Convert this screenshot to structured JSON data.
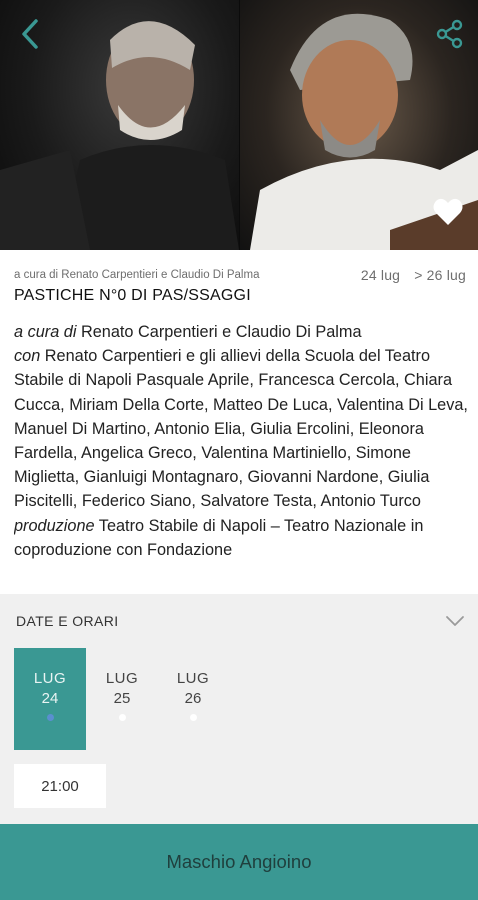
{
  "hero": {
    "back_icon": "chevron-left-icon",
    "share_icon": "share-icon",
    "favorite_icon": "heart-icon",
    "accent_color": "#3a9893"
  },
  "show": {
    "credit": "a cura di Renato Carpentieri e Claudio Di Palma",
    "date_start": "24 lug",
    "date_end": "> 26 lug",
    "title": "PASTICHE N°0 DI PAS/SSAGGI",
    "description": [
      {
        "label": "a cura di",
        "text": " Renato Carpentieri e Claudio Di Palma"
      },
      {
        "label": "con",
        "text": " Renato Carpentieri e gli allievi della Scuola del Teatro Stabile di Napoli Pasquale Aprile, Francesca Cercola, Chiara Cucca, Miriam Della Corte, Matteo De Luca, Valentina Di Leva, Manuel Di Martino, Antonio Elia, Giulia Ercolini, Eleonora Fardella, Angelica Greco, Valentina Martiniello, Simone Miglietta, Gianluigi Montagnaro, Giovanni Nardone, Giulia Piscitelli, Federico Siano, Salvatore Testa, Antonio Turco"
      },
      {
        "label": "produzione",
        "text": " Teatro Stabile di Napoli – Teatro Nazionale in coproduzione con Fondazione"
      }
    ]
  },
  "schedule": {
    "heading": "DATE E ORARI",
    "chevron_icon": "chevron-down-icon",
    "days": [
      {
        "month": "LUG",
        "day": "24",
        "selected": true
      },
      {
        "month": "LUG",
        "day": "25",
        "selected": false
      },
      {
        "month": "LUG",
        "day": "26",
        "selected": false
      }
    ],
    "time": "21:00"
  },
  "venue": {
    "label": "Maschio Angioino"
  }
}
